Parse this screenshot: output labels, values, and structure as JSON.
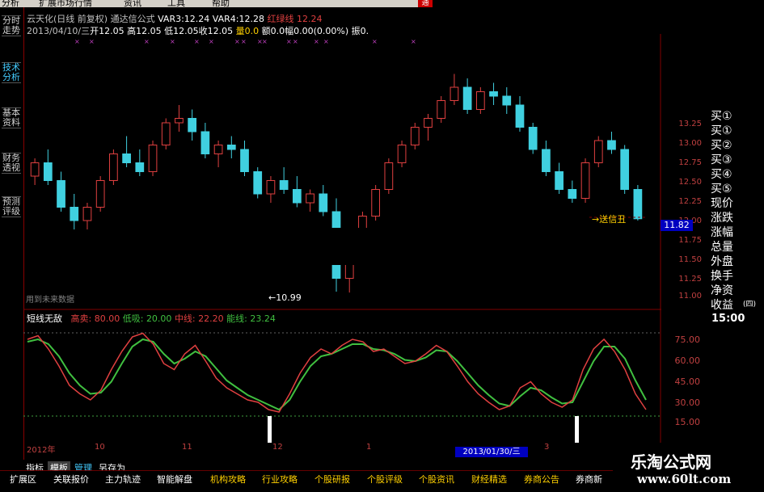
{
  "menu": {
    "items": [
      "分析",
      "扩展市场行情",
      "资讯",
      "工具",
      "帮助"
    ],
    "right_badge": "通"
  },
  "side_tabs": [
    "分时走势",
    "技术分析",
    "基本资料",
    "财务透视",
    "预测评级"
  ],
  "header": {
    "line1": {
      "stock": "云天化(日线 前复权)",
      "formula": "通达信公式",
      "var3_label": "VAR3:",
      "var3": "12.24",
      "var4_label": "VAR4:",
      "var4": "12.28",
      "hong": "红绿线",
      "hong_val": "12.24"
    },
    "line2": {
      "date": "2013/04/10/三",
      "open": "开12.05",
      "high": "高12.05",
      "low": "低12.05",
      "close": "收12.05",
      "vol": "量0.0",
      "amt": "额0.0",
      "change": "幅0.00(0.00%)",
      "zhen": "振0."
    }
  },
  "annotations": {
    "low_label": "←10.99",
    "side_label": "用到未来数据",
    "signal": "→送信丑"
  },
  "price_axis": [
    "13.25",
    "13.00",
    "12.75",
    "12.50",
    "12.25",
    "12.00",
    "11.75",
    "11.50",
    "11.25",
    "11.00"
  ],
  "current_price": "11.82",
  "quote_labels": [
    "买①",
    "买①",
    "买②",
    "买③",
    "买④",
    "买⑤",
    "现价",
    "涨跌",
    "涨幅",
    "总量",
    "外盘",
    "换手",
    "净资",
    "收益"
  ],
  "quote_extra": "(四)",
  "time": "15:00",
  "indicator": {
    "name": "短线无敌",
    "high_label": "高卖:",
    "high": "80.00",
    "low_label": "低吸:",
    "low": "20.00",
    "mid_label": "中线:",
    "mid": "22.20",
    "neng_label": "能线:",
    "neng": "23.24",
    "axis": [
      "75.00",
      "60.00",
      "45.00",
      "30.00",
      "15.00"
    ]
  },
  "x_axis": [
    "2012年",
    "10",
    "11",
    "12",
    "1",
    "3"
  ],
  "date_box": "2013/01/30/三",
  "bottom_tabs": [
    "指标",
    "模板",
    "管理",
    "另存为"
  ],
  "func_bar": [
    "扩展区",
    "关联报价",
    "主力轨迹",
    "智能解盘",
    "机构攻略",
    "行业攻略",
    "个股研报",
    "个股评级",
    "个股资讯",
    "财经精选",
    "券商公告",
    "券商新"
  ],
  "watermark": {
    "line1": "乐淘公式网",
    "line2": "www.60lt.com"
  },
  "colors": {
    "up": "#e04040",
    "down": "#40d0e0",
    "grid": "#800000",
    "k_line": "#e04040",
    "d_line": "#40c040"
  },
  "chart_data": {
    "type": "candlestick",
    "y_range": [
      10.9,
      13.4
    ],
    "candles": [
      [
        12.3,
        12.5,
        12.2,
        12.45
      ],
      [
        12.45,
        12.6,
        12.2,
        12.25
      ],
      [
        12.25,
        12.35,
        11.9,
        11.95
      ],
      [
        11.95,
        12.1,
        11.7,
        11.8
      ],
      [
        11.8,
        12.0,
        11.7,
        11.95
      ],
      [
        11.95,
        12.3,
        11.9,
        12.25
      ],
      [
        12.25,
        12.6,
        12.2,
        12.55
      ],
      [
        12.55,
        12.75,
        12.4,
        12.45
      ],
      [
        12.45,
        12.6,
        12.3,
        12.35
      ],
      [
        12.35,
        12.7,
        12.3,
        12.65
      ],
      [
        12.65,
        12.95,
        12.6,
        12.9
      ],
      [
        12.9,
        13.1,
        12.8,
        12.95
      ],
      [
        12.95,
        13.05,
        12.7,
        12.8
      ],
      [
        12.8,
        12.9,
        12.5,
        12.55
      ],
      [
        12.55,
        12.7,
        12.4,
        12.65
      ],
      [
        12.65,
        12.75,
        12.5,
        12.6
      ],
      [
        12.6,
        12.7,
        12.3,
        12.35
      ],
      [
        12.35,
        12.4,
        12.05,
        12.1
      ],
      [
        12.1,
        12.3,
        12.0,
        12.25
      ],
      [
        12.25,
        12.4,
        12.1,
        12.15
      ],
      [
        12.15,
        12.3,
        11.95,
        12.0
      ],
      [
        12.0,
        12.15,
        11.9,
        12.1
      ],
      [
        12.1,
        12.2,
        11.85,
        11.9
      ],
      [
        11.9,
        12.05,
        11.0,
        11.15
      ],
      [
        11.15,
        11.4,
        10.99,
        11.35
      ],
      [
        11.35,
        11.9,
        11.3,
        11.85
      ],
      [
        11.85,
        12.2,
        11.8,
        12.15
      ],
      [
        12.15,
        12.5,
        12.1,
        12.45
      ],
      [
        12.45,
        12.7,
        12.4,
        12.65
      ],
      [
        12.65,
        12.9,
        12.6,
        12.85
      ],
      [
        12.85,
        13.0,
        12.7,
        12.95
      ],
      [
        12.95,
        13.2,
        12.9,
        13.15
      ],
      [
        13.15,
        13.45,
        13.1,
        13.3
      ],
      [
        13.3,
        13.4,
        13.0,
        13.05
      ],
      [
        13.05,
        13.3,
        13.0,
        13.25
      ],
      [
        13.25,
        13.35,
        13.1,
        13.2
      ],
      [
        13.2,
        13.3,
        13.0,
        13.1
      ],
      [
        13.1,
        13.2,
        12.8,
        12.85
      ],
      [
        12.85,
        12.9,
        12.55,
        12.6
      ],
      [
        12.6,
        12.7,
        12.3,
        12.35
      ],
      [
        12.35,
        12.45,
        12.1,
        12.15
      ],
      [
        12.15,
        12.25,
        12.0,
        12.05
      ],
      [
        12.05,
        12.5,
        12.0,
        12.45
      ],
      [
        12.45,
        12.75,
        12.4,
        12.7
      ],
      [
        12.7,
        12.8,
        12.55,
        12.6
      ],
      [
        12.6,
        12.65,
        12.1,
        12.15
      ],
      [
        12.15,
        12.2,
        11.8,
        11.82
      ]
    ],
    "k_series": [
      80,
      83,
      72,
      58,
      42,
      35,
      30,
      38,
      55,
      70,
      82,
      85,
      76,
      60,
      55,
      68,
      75,
      62,
      48,
      40,
      35,
      30,
      28,
      22,
      20,
      35,
      52,
      65,
      72,
      68,
      75,
      80,
      78,
      70,
      72,
      66,
      60,
      62,
      68,
      75,
      70,
      58,
      45,
      35,
      28,
      22,
      25,
      40,
      45,
      35,
      28,
      24,
      30,
      55,
      72,
      80,
      70,
      55,
      35,
      22
    ],
    "d_series": [
      78,
      80,
      76,
      66,
      52,
      42,
      35,
      36,
      45,
      60,
      74,
      80,
      78,
      68,
      60,
      64,
      70,
      66,
      56,
      46,
      40,
      34,
      30,
      26,
      22,
      30,
      45,
      58,
      66,
      68,
      72,
      76,
      76,
      72,
      71,
      68,
      63,
      62,
      65,
      71,
      70,
      62,
      52,
      42,
      34,
      27,
      25,
      33,
      40,
      38,
      32,
      27,
      28,
      45,
      62,
      74,
      74,
      64,
      46,
      30
    ]
  }
}
